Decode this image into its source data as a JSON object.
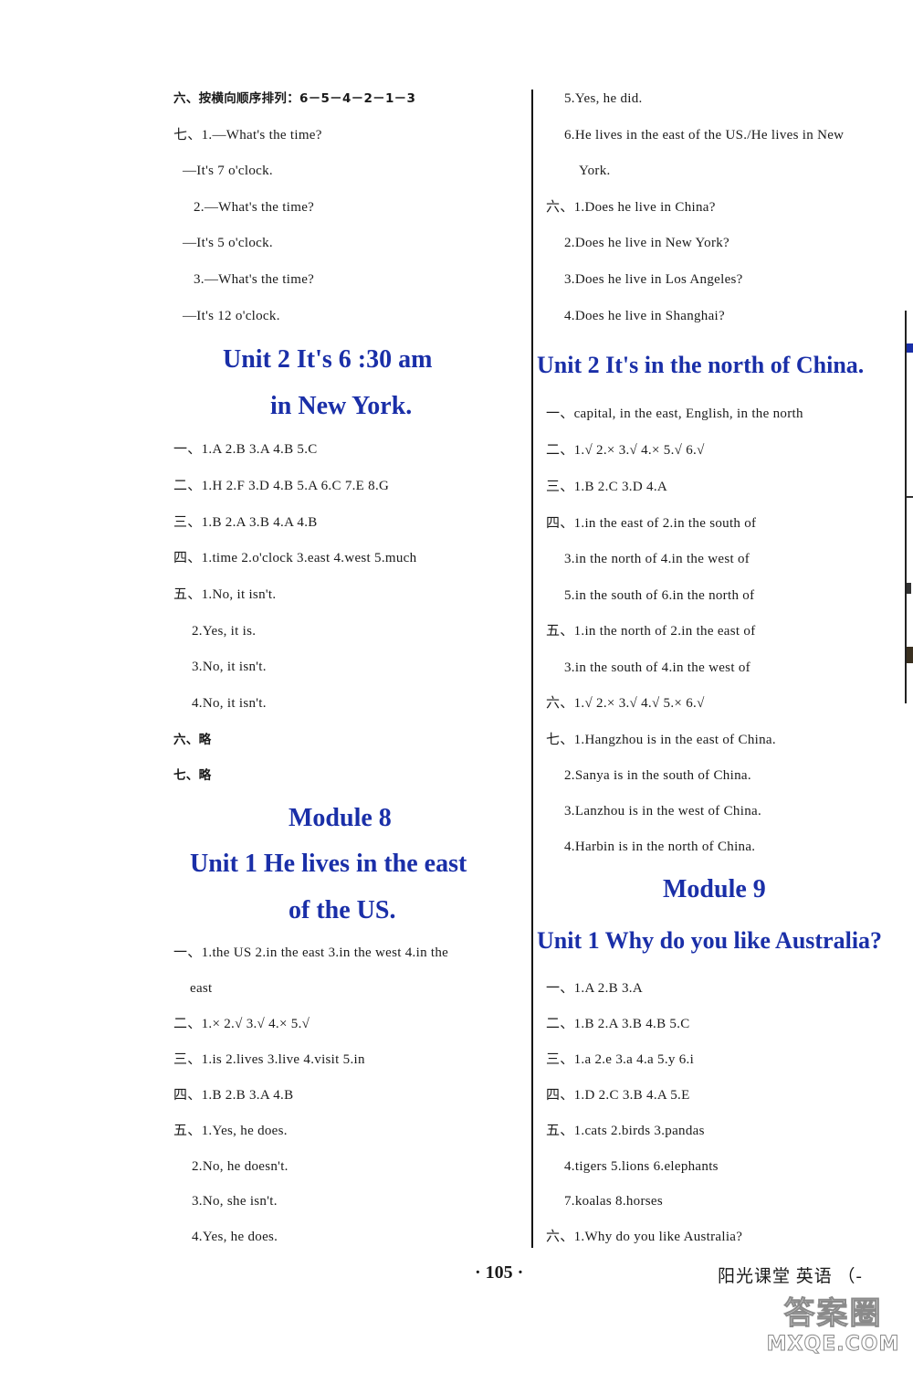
{
  "left_column": {
    "lines": [
      {
        "text": "六、按横向顺序排列：6－5－4－2－1－3",
        "bold": true
      },
      {
        "text": "七、1.—What's the time?"
      },
      {
        "text": "    —It's 7 o'clock."
      },
      {
        "text": "  2.—What's the time?"
      },
      {
        "text": "    —It's 5 o'clock."
      },
      {
        "text": "  3.—What's the time?"
      },
      {
        "text": "    —It's 12 o'clock."
      }
    ],
    "unit2_heading": [
      "Unit 2    It's 6 :30 am",
      "in New York."
    ],
    "unit2_lines": [
      "一、1.A   2.B   3.A   4.B   5.C",
      "二、1.H   2.F   3.D   4.B   5.A   6.C   7.E   8.G",
      "三、1.B   2.A   3.B   4.A   4.B",
      "四、1.time   2.o'clock   3.east   4.west   5.much",
      "五、1.No, it isn't.",
      "  2.Yes, it is.",
      "  3.No, it isn't.",
      "  4.No, it isn't.",
      "六、略",
      "七、略"
    ],
    "module8_heading": "Module 8",
    "module8_unit1_heading": [
      "Unit 1    He lives in the east",
      "of the US."
    ],
    "module8_unit1_lines": [
      "一、1.the US   2.in the east   3.in the west   4.in the",
      "  east",
      "二、1.×   2.√   3.√   4.×   5.√",
      "三、1.is   2.lives   3.live   4.visit   5.in",
      "四、1.B   2.B   3.A   4.B",
      "五、1.Yes, he does.",
      "  2.No, he doesn't.",
      "  3.No, she isn't.",
      "  4.Yes, he does."
    ]
  },
  "right_column": {
    "lines": [
      "  5.Yes, he did.",
      "  6.He lives in the east of the US./He lives in New",
      "    York.",
      "六、1.Does he live in China?",
      "  2.Does he live in New York?",
      "  3.Does he live in Los Angeles?",
      "  4.Does he live in Shanghai?"
    ],
    "unit2_heading": "Unit 2    It's in the north of China.",
    "unit2_lines": [
      "一、capital, in the east, English, in the north",
      "二、1.√   2.×   3.√   4.×   5.√     6.√",
      "三、1.B   2.C   3.D   4.A",
      "四、1.in the east of   2.in the south of",
      "  3.in the north of   4.in the west of",
      "  5.in the south of   6.in the north of",
      "五、1.in the north of   2.in the east of",
      "  3.in the south of   4.in the west of",
      "六、1.√   2.×   3.√   4.√   5.×   6.√",
      "七、1.Hangzhou is in the east of China.",
      "  2.Sanya is in the south of China.",
      "  3.Lanzhou is in the west of China.",
      "  4.Harbin is in the north of China."
    ],
    "module9_heading": "Module 9",
    "module9_unit1_heading": "Unit 1    Why do you like Australia?",
    "module9_unit1_lines": [
      "一、1.A   2.B   3.A",
      "二、1.B   2.A   3.B   4.B   5.C",
      "三、1.a   2.e   3.a   4.a   5.y   6.i",
      "四、1.D   2.C   3.B   4.A   5.E",
      "五、1.cats   2.birds   3.pandas",
      "  4.tigers   5.lions   6.elephants",
      "  7.koalas   8.horses",
      "六、1.Why do you like Australia?"
    ]
  },
  "footer": {
    "page_number": "· 105 ·",
    "book_title": "阳光课堂   英语  （-"
  },
  "watermark": {
    "line1": "答案圈",
    "line2": "MXQE.COM"
  },
  "colors": {
    "heading_blue": "#1a2fa8",
    "text": "#1a1a1a"
  }
}
